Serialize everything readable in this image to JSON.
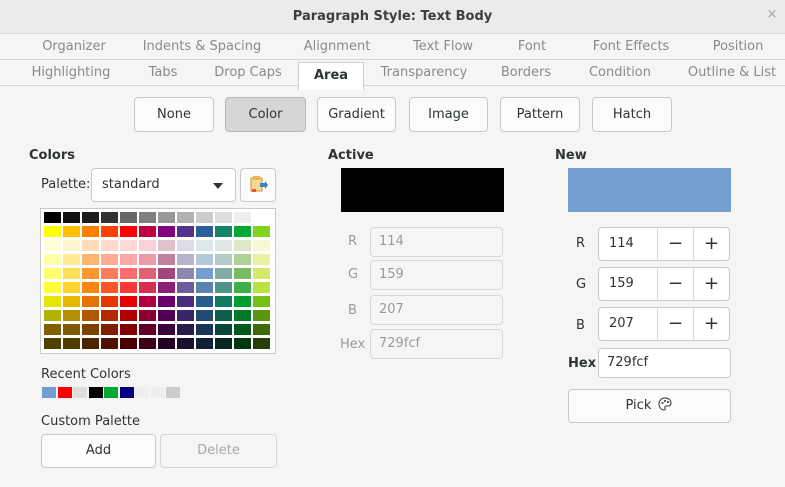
{
  "window": {
    "title": "Paragraph Style: Text Body",
    "close_glyph": "×"
  },
  "tabs_row1": [
    "Organizer",
    "Indents & Spacing",
    "Alignment",
    "Text Flow",
    "Font",
    "Font Effects",
    "Position"
  ],
  "tabs_row2": [
    "Highlighting",
    "Tabs",
    "Drop Caps",
    "Area",
    "Transparency",
    "Borders",
    "Condition",
    "Outline & List"
  ],
  "active_tab": "Area",
  "fill_buttons": [
    "None",
    "Color",
    "Gradient",
    "Image",
    "Pattern",
    "Hatch"
  ],
  "selected_fill": "Color",
  "colors": {
    "title": "Colors",
    "palette_label": "Palette:",
    "palette_value": "standard",
    "palette_icon": "palette-load-icon",
    "grid_colors": [
      [
        "#000000",
        "#111111",
        "#1c1c1c",
        "#333333",
        "#666666",
        "#808080",
        "#999999",
        "#b2b2b2",
        "#cccccc",
        "#dddddd",
        "#eeeeee",
        "#ffffff"
      ],
      [
        "#ffff00",
        "#ffbf00",
        "#ff8000",
        "#ff4000",
        "#ff0000",
        "#bf0041",
        "#800080",
        "#55308d",
        "#2a6099",
        "#158466",
        "#00a933",
        "#81d41a"
      ],
      [
        "#ffffd7",
        "#fff5ce",
        "#ffdbb6",
        "#ffd8ce",
        "#ffd7d7",
        "#f7d1d5",
        "#e0c2cd",
        "#dedce6",
        "#dee6ef",
        "#dee7e5",
        "#dde8cb",
        "#f6f9d4"
      ],
      [
        "#ffffa6",
        "#ffe994",
        "#ffb66c",
        "#ffaa95",
        "#ffa6a6",
        "#ec9ba4",
        "#bf819e",
        "#b7b3ca",
        "#b4c7dc",
        "#b3cac7",
        "#afd095",
        "#e8f2a1"
      ],
      [
        "#ffff6d",
        "#ffde59",
        "#ff972f",
        "#ff7b59",
        "#ff6d6d",
        "#e16173",
        "#a1467e",
        "#8e86ae",
        "#729fcf",
        "#81aca6",
        "#77bc65",
        "#d4ea6b"
      ],
      [
        "#ffff38",
        "#ffd428",
        "#ff860d",
        "#ff5429",
        "#ff3838",
        "#d62e4e",
        "#8d1d75",
        "#6b5e9b",
        "#5983b0",
        "#50938a",
        "#3faf46",
        "#bbe33d"
      ],
      [
        "#e6e600",
        "#e6b800",
        "#e67300",
        "#e63600",
        "#e60000",
        "#b00040",
        "#6b006b",
        "#4b2d7f",
        "#2a5d8f",
        "#127a5f",
        "#009e2f",
        "#73bf12"
      ],
      [
        "#b2b200",
        "#b28f00",
        "#b25900",
        "#b22a00",
        "#b20000",
        "#8a0033",
        "#540054",
        "#3a2366",
        "#214b73",
        "#0e604b",
        "#007a25",
        "#5a960e"
      ],
      [
        "#806000",
        "#805900",
        "#804000",
        "#801f00",
        "#800000",
        "#640026",
        "#3c003c",
        "#2a1b4d",
        "#183758",
        "#0a4636",
        "#005a1b",
        "#406a0a"
      ],
      [
        "#4d4000",
        "#4d3b00",
        "#4d2600",
        "#4d1300",
        "#4d0000",
        "#3d0017",
        "#240024",
        "#1a112e",
        "#0f2134",
        "#062a21",
        "#003610",
        "#263f06"
      ]
    ],
    "recent_label": "Recent Colors",
    "recent_colors": [
      "#729fcf",
      "#ff0000",
      "#dddddd",
      "#000000",
      "#00a933",
      "#000080",
      "#eeeeee",
      "#eeeeee",
      "#cccccc"
    ],
    "custom_label": "Custom Palette",
    "add_label": "Add",
    "delete_label": "Delete"
  },
  "active": {
    "title": "Active",
    "color": "#000000",
    "r_label": "R",
    "r_value": "114",
    "g_label": "G",
    "g_value": "159",
    "b_label": "B",
    "b_value": "207",
    "hex_label": "Hex",
    "hex_value": "729fcf"
  },
  "new": {
    "title": "New",
    "color": "#729fcf",
    "r_label": "R",
    "r_value": "114",
    "g_label": "G",
    "g_value": "159",
    "b_label": "B",
    "b_value": "207",
    "minus_glyph": "−",
    "plus_glyph": "+",
    "hex_label": "Hex",
    "hex_value": "729fcf",
    "pick_label": "Pick",
    "pick_icon": "palette-icon"
  }
}
